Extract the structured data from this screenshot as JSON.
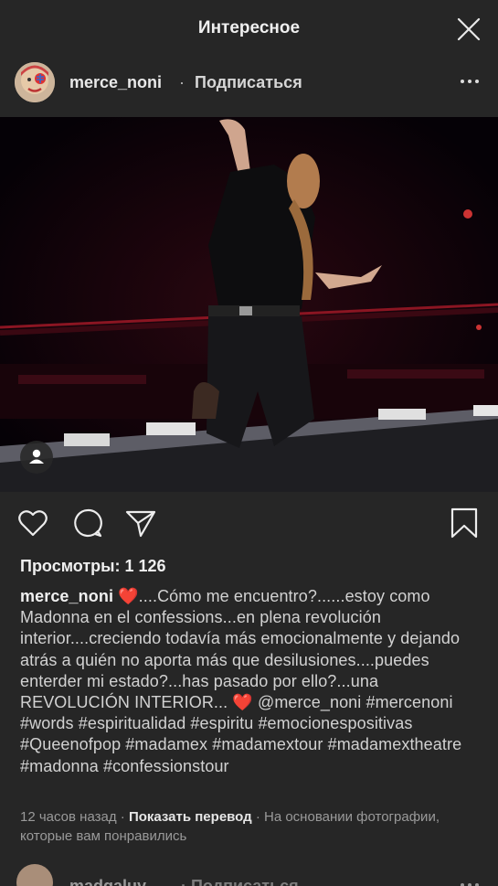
{
  "header": {
    "title": "Интересное"
  },
  "post": {
    "author": "merce_noni",
    "separator": "·",
    "follow_label": "Подписаться",
    "views_label": "Просмотры: 1 126",
    "caption": {
      "username": "merce_noni",
      "text_1": "....Cómo me encuentro?......estoy como  Madonna en el confessions...en plena revolución interior....creciendo todavía más emocionalmente y dejando atrás a quién no aporta más que desilusiones....puedes enterder mi estado?...has pasado por ello?...una REVOLUCIÓN INTERIOR...",
      "text_2": " @merce_noni #mercenoni #words #espiritualidad #espiritu #emocionespositivas #Queenofpop #madamex #madamextour #madamextheatre #madonna #confessionstour"
    },
    "meta": {
      "time": "12 часов назад",
      "dot": " · ",
      "translate_label": "Показать перевод",
      "reason": " · На основании фотографии, которые вам понравились"
    }
  },
  "next_post": {
    "author": "madgaluy",
    "follow_label": "· Подписаться"
  },
  "icons": {
    "close": "close-icon",
    "more": "more-dots-icon",
    "like": "heart-icon",
    "comment": "comment-icon",
    "share": "send-icon",
    "save": "bookmark-icon",
    "tag": "user-tag-icon",
    "caption_heart": "❤️"
  },
  "colors": {
    "background": "#262626",
    "heart": "#ed2a2a",
    "text": "#d2d2d2",
    "muted": "#9a9a9a"
  }
}
